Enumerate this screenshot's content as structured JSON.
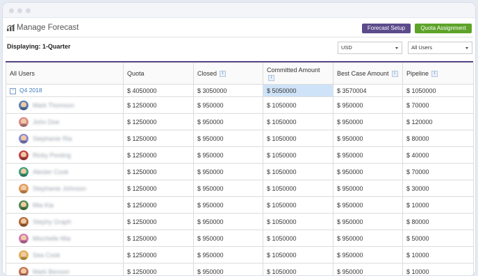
{
  "header": {
    "title": "Manage Forecast",
    "forecast_setup_label": "Forecast Setup",
    "quota_assignment_label": "Quota Assignment"
  },
  "filters": {
    "displaying": "Displaying: 1-Quarter",
    "currency": "USD",
    "users": "All Users"
  },
  "table": {
    "columns": [
      "All Users",
      "Quota",
      "Closed",
      "Committed Amount",
      "Best Case Amount",
      "Pipeline"
    ],
    "info_icon": "i",
    "quarter_row": {
      "label": "Q4 2018",
      "quota": "$ 4050000",
      "closed": "$ 3050000",
      "committed": "$ 5050000",
      "best_case": "$ 3570004",
      "pipeline": "$ 1050000"
    },
    "rows": [
      {
        "name": "Mark Thomson",
        "avatar_color": "#5a7fb5",
        "quota": "$ 1250000",
        "closed": "$ 950000",
        "committed": "$ 1050000",
        "best_case": "$ 950000",
        "pipeline": "$ 70000"
      },
      {
        "name": "John Doe",
        "avatar_color": "#d98a8a",
        "quota": "$ 1250000",
        "closed": "$ 950000",
        "committed": "$ 1050000",
        "best_case": "$ 950000",
        "pipeline": "$ 120000"
      },
      {
        "name": "Stephanie Ria",
        "avatar_color": "#8a8ad0",
        "quota": "$ 1250000",
        "closed": "$ 950000",
        "committed": "$ 1050000",
        "best_case": "$ 950000",
        "pipeline": "$ 80000"
      },
      {
        "name": "Ricky Ponting",
        "avatar_color": "#c04040",
        "quota": "$ 1250000",
        "closed": "$ 950000",
        "committed": "$ 1050000",
        "best_case": "$ 950000",
        "pipeline": "$ 40000"
      },
      {
        "name": "Alester Cook",
        "avatar_color": "#3aa07a",
        "quota": "$ 1250000",
        "closed": "$ 950000",
        "committed": "$ 1050000",
        "best_case": "$ 950000",
        "pipeline": "$ 70000"
      },
      {
        "name": "Stephanie Johnson",
        "avatar_color": "#e09a5a",
        "quota": "$ 1250000",
        "closed": "$ 950000",
        "committed": "$ 1050000",
        "best_case": "$ 950000",
        "pipeline": "$ 30000"
      },
      {
        "name": "Mia Kia",
        "avatar_color": "#4b8a4b",
        "quota": "$ 1250000",
        "closed": "$ 950000",
        "committed": "$ 1050000",
        "best_case": "$ 950000",
        "pipeline": "$ 10000"
      },
      {
        "name": "Stephy Graph",
        "avatar_color": "#b06a3a",
        "quota": "$ 1250000",
        "closed": "$ 950000",
        "committed": "$ 1050000",
        "best_case": "$ 950000",
        "pipeline": "$ 80000"
      },
      {
        "name": "Mischelle Mia",
        "avatar_color": "#d07ab0",
        "quota": "$ 1250000",
        "closed": "$ 950000",
        "committed": "$ 1050000",
        "best_case": "$ 950000",
        "pipeline": "$ 50000"
      },
      {
        "name": "Sea Cook",
        "avatar_color": "#e0b050",
        "quota": "$ 1250000",
        "closed": "$ 950000",
        "committed": "$ 1050000",
        "best_case": "$ 950000",
        "pipeline": "$ 10000"
      },
      {
        "name": "Mark Benson",
        "avatar_color": "#c07050",
        "quota": "$ 1250000",
        "closed": "$ 950000",
        "committed": "$ 1050000",
        "best_case": "$ 950000",
        "pipeline": "$ 10000"
      }
    ]
  },
  "colors": {
    "accent": "#5b4b8a",
    "green": "#5da32a",
    "link": "#3d7cc0",
    "highlight": "#cfe3f8"
  }
}
